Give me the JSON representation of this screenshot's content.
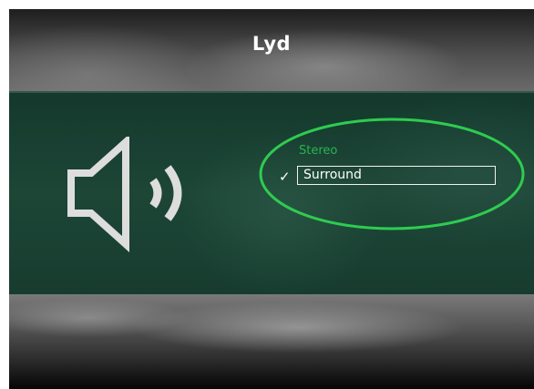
{
  "screen": {
    "title": "Lyd"
  },
  "audio_options": {
    "items": [
      {
        "label": "Stereo",
        "selected": false
      },
      {
        "label": "Surround",
        "selected": true
      }
    ],
    "selected_marker": "✓",
    "highlight_color": "#2ecc4f"
  },
  "colors": {
    "panel": "#1a4133",
    "option_inactive": "#28b44e",
    "option_active": "#ffffff"
  },
  "icons": {
    "speaker": "speaker-volume-icon",
    "check": "check-icon"
  }
}
